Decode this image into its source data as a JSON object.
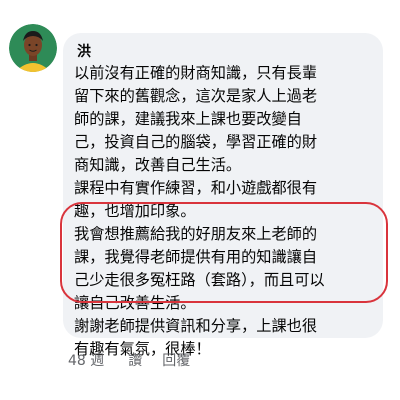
{
  "comment": {
    "author": "洪",
    "avatar_icon": "user-avatar-icon",
    "lines": [
      "以前沒有正確的財商知識，只有長輩",
      "留下來的舊觀念，這次是家人上過老",
      "師的課，建議我來上課也要改變自",
      "己，投資自己的腦袋，學習正確的財",
      "商知識，改善自己生活。",
      "課程中有實作練習，和小遊戲都很有",
      "趣，也增加印象。",
      "我會想推薦給我的好朋友來上老師的",
      "課，我覺得老師提供有用的知識讓自",
      "己少走很多冤枉路（套路），而且可以",
      "讓自己改善生活。",
      "謝謝老師提供資訊和分享，上課也很",
      "有趣有氣氛，很棒！"
    ],
    "timestamp": "48 週",
    "like_label": "讚",
    "reply_label": "回覆"
  },
  "colors": {
    "bubble_bg": "#f0f2f5",
    "text": "#050505",
    "meta_text": "#65676b",
    "highlight": "#d9343c",
    "avatar_bg": "#2e8b57"
  }
}
